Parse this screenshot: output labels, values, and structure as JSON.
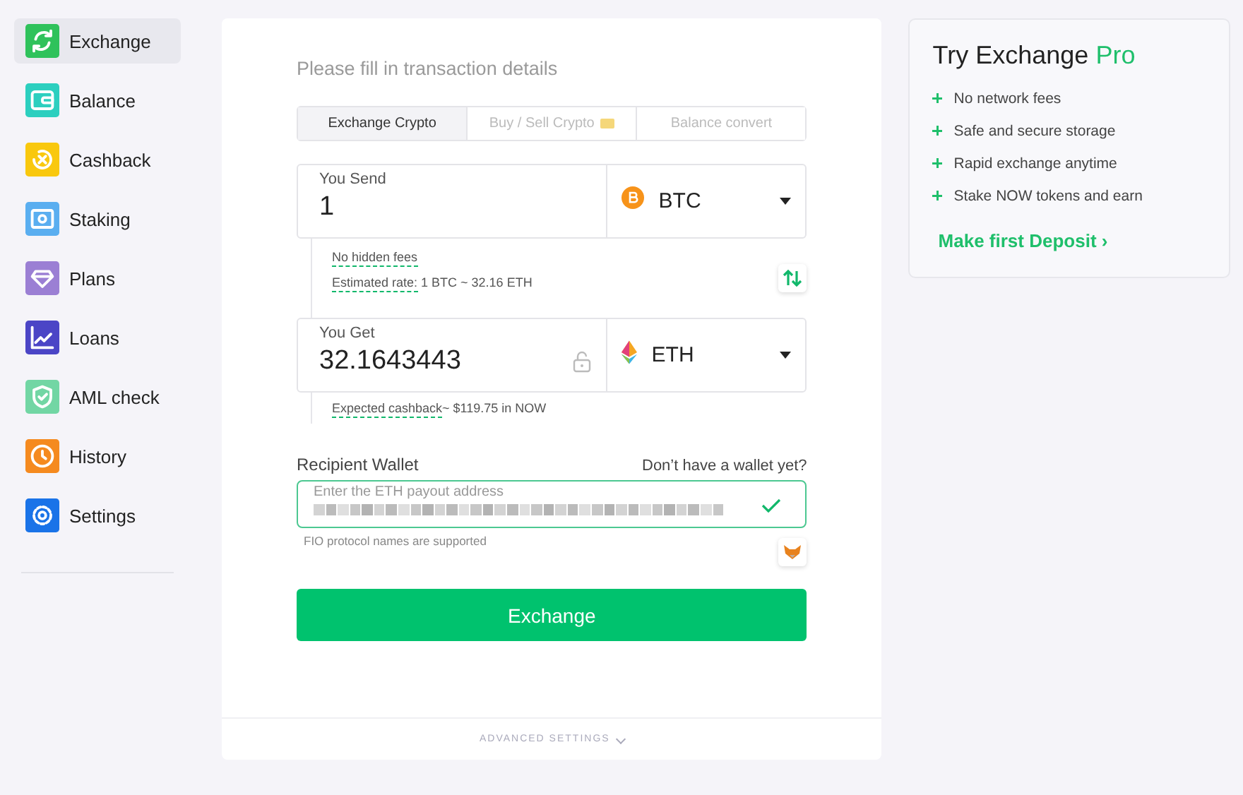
{
  "sidebar": {
    "items": [
      {
        "label": "Exchange",
        "selected": true,
        "color": "#2fc25b"
      },
      {
        "label": "Balance",
        "selected": false,
        "color": "#2ccfbf"
      },
      {
        "label": "Cashback",
        "selected": false,
        "color": "#f9c80e"
      },
      {
        "label": "Staking",
        "selected": false,
        "color": "#5aaef0"
      },
      {
        "label": "Plans",
        "selected": false,
        "color": "#9b7fd4"
      },
      {
        "label": "Loans",
        "selected": false,
        "color": "#4b45c6"
      },
      {
        "label": "AML check",
        "selected": false,
        "color": "#72d6a4"
      },
      {
        "label": "History",
        "selected": false,
        "color": "#f58a1f"
      },
      {
        "label": "Settings",
        "selected": false,
        "color": "#1a73e8"
      }
    ]
  },
  "form": {
    "heading": "Please fill in transaction details",
    "tabs": [
      {
        "label": "Exchange Crypto",
        "selected": true
      },
      {
        "label": "Buy / Sell Crypto",
        "selected": false
      },
      {
        "label": "Balance convert",
        "selected": false
      }
    ],
    "send": {
      "label": "You Send",
      "value": "1",
      "currency": "BTC"
    },
    "notes": [
      {
        "label": "No hidden fees"
      },
      {
        "label": "Estimated rate:",
        "value": " 1 BTC ~ 32.16 ETH"
      }
    ],
    "get": {
      "label": "You Get",
      "value": "32.1643443",
      "currency": "ETH",
      "locked": false
    },
    "cashback": {
      "label": "Expected cashback",
      "value": "~ $119.75 in NOW"
    },
    "wallet": {
      "label": "Recipient Wallet",
      "link": "Don’t have a wallet yet?",
      "placeholder": "Enter the ETH payout address",
      "value_hidden": true,
      "valid": true,
      "hint": "FIO protocol names are supported"
    },
    "submit": "Exchange",
    "advanced": "ADVANCED SETTINGS"
  },
  "promo": {
    "title": "Try Exchange ",
    "title_accent": "Pro",
    "features": [
      "No network fees",
      "Safe and secure storage",
      "Rapid exchange anytime",
      "Stake NOW tokens and earn"
    ],
    "link": "Make first Deposit ›"
  }
}
